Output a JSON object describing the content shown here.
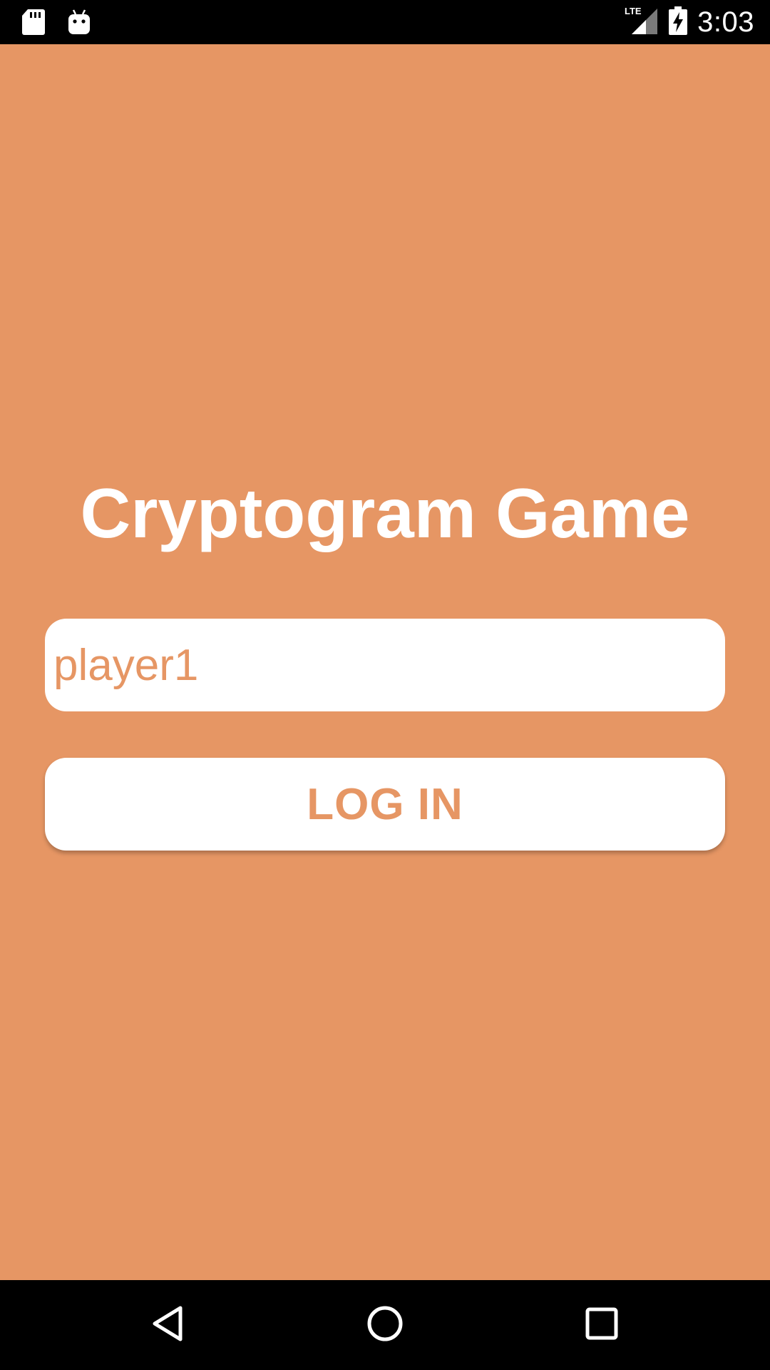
{
  "status_bar": {
    "time": "3:03",
    "network": "LTE",
    "left_icons": [
      "sd-card-icon",
      "android-debug-icon"
    ],
    "right_icons": [
      "lte-signal-icon",
      "battery-charging-icon"
    ]
  },
  "screen": {
    "title": "Cryptogram Game",
    "username_field": {
      "value": "player1"
    },
    "login_button": {
      "label": "LOG IN"
    }
  },
  "nav_bar": {
    "icons": [
      "back-icon",
      "home-icon",
      "recents-icon"
    ]
  },
  "colors": {
    "background": "#e69664",
    "accent_text": "#e69664",
    "white": "#ffffff",
    "system_bar": "#000000"
  }
}
